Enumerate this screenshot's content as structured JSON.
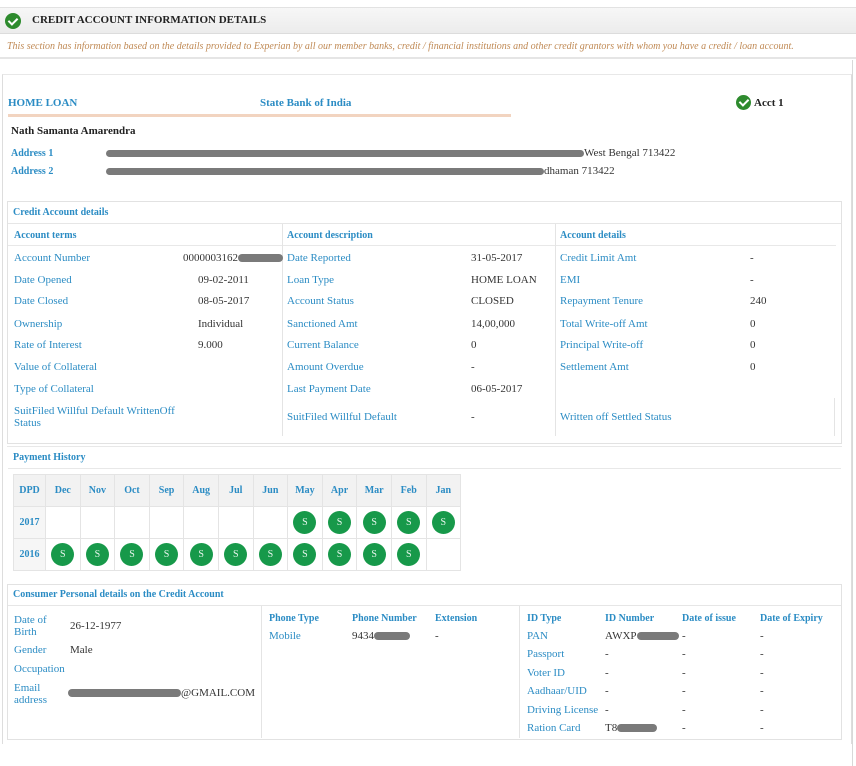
{
  "header": {
    "title": "CREDIT ACCOUNT INFORMATION DETAILS",
    "icon": "check-circle-icon",
    "intro": "This section has information based on the details provided to Experian by all our member banks, credit / financial institutions and other credit grantors with whom you have a credit / loan account."
  },
  "account": {
    "type": "HOME LOAN",
    "bank": "State Bank of India",
    "badge": "Acct 1",
    "holder_name": "Nath Samanta Amarendra",
    "address1_label": "Address 1",
    "address1_suffix": "West Bengal 713422",
    "address2_label": "Address 2",
    "address2_suffix": "dhaman 713422"
  },
  "credit_details": {
    "title": "Credit Account details",
    "columns": [
      {
        "heading": "Account terms",
        "rows": [
          {
            "label": "Account Number",
            "value": "0000003162"
          },
          {
            "label": "Date Opened",
            "value": "09-02-2011"
          },
          {
            "label": "Date Closed",
            "value": "08-05-2017"
          },
          {
            "label": "Ownership",
            "value": "Individual"
          },
          {
            "label": "Rate of Interest",
            "value": "9.000"
          },
          {
            "label": "Value of Collateral",
            "value": ""
          },
          {
            "label": "Type of Collateral",
            "value": ""
          },
          {
            "label": "SuitFiled Willful Default WrittenOff Status",
            "value": ""
          }
        ]
      },
      {
        "heading": "Account description",
        "rows": [
          {
            "label": "Date Reported",
            "value": "31-05-2017"
          },
          {
            "label": "Loan Type",
            "value": "HOME LOAN"
          },
          {
            "label": "Account Status",
            "value": "CLOSED"
          },
          {
            "label": "Sanctioned Amt",
            "value": "14,00,000"
          },
          {
            "label": "Current Balance",
            "value": "0"
          },
          {
            "label": "Amount Overdue",
            "value": "-"
          },
          {
            "label": "Last Payment Date",
            "value": "06-05-2017"
          },
          {
            "label": "SuitFiled Willful Default",
            "value": "-"
          }
        ]
      },
      {
        "heading": "Account details",
        "rows": [
          {
            "label": "Credit Limit Amt",
            "value": "-"
          },
          {
            "label": "EMI",
            "value": "-"
          },
          {
            "label": "Repayment Tenure",
            "value": "240"
          },
          {
            "label": "Total Write-off Amt",
            "value": "0"
          },
          {
            "label": "Principal Write-off",
            "value": "0"
          },
          {
            "label": "Settlement Amt",
            "value": "0"
          },
          {
            "label": "",
            "value": ""
          },
          {
            "label": "Written off Settled Status",
            "value": ""
          }
        ]
      }
    ]
  },
  "payment_history": {
    "title": "Payment History",
    "corner": "DPD",
    "months": [
      "Dec",
      "Nov",
      "Oct",
      "Sep",
      "Aug",
      "Jul",
      "Jun",
      "May",
      "Apr",
      "Mar",
      "Feb",
      "Jan"
    ],
    "years": [
      {
        "year": "2017",
        "cells": [
          "",
          "",
          "",
          "",
          "",
          "",
          "",
          "S",
          "S",
          "S",
          "S",
          "S"
        ]
      },
      {
        "year": "2016",
        "cells": [
          "S",
          "S",
          "S",
          "S",
          "S",
          "S",
          "S",
          "S",
          "S",
          "S",
          "S",
          ""
        ]
      }
    ],
    "status_color": "#17994a"
  },
  "personal": {
    "title": "Consumer Personal details on the Credit Account",
    "fields": [
      {
        "label": "Date of Birth",
        "value": "26-12-1977"
      },
      {
        "label": "Gender",
        "value": "Male"
      },
      {
        "label": "Occupation",
        "value": ""
      },
      {
        "label": "Email address",
        "value": "@GMAIL.COM"
      }
    ],
    "phones": {
      "headers": [
        "Phone Type",
        "Phone Number",
        "Extension"
      ],
      "rows": [
        [
          "Mobile",
          "9434",
          "-"
        ]
      ]
    },
    "ids": {
      "headers": [
        "ID Type",
        "ID Number",
        "Date of issue",
        "Date of Expiry"
      ],
      "rows": [
        [
          "PAN",
          "AWXP",
          "-",
          "-"
        ],
        [
          "Passport",
          "-",
          "-",
          "-"
        ],
        [
          "Voter ID",
          "-",
          "-",
          "-"
        ],
        [
          "Aadhaar/UID",
          "-",
          "-",
          "-"
        ],
        [
          "Driving License",
          "-",
          "-",
          "-"
        ],
        [
          "Ration Card",
          "T8",
          "-",
          "-"
        ]
      ]
    }
  },
  "colors": {
    "label_blue": "#2b8cc4",
    "intro_text": "#c08a55",
    "check_green": "#2e8b2e"
  }
}
